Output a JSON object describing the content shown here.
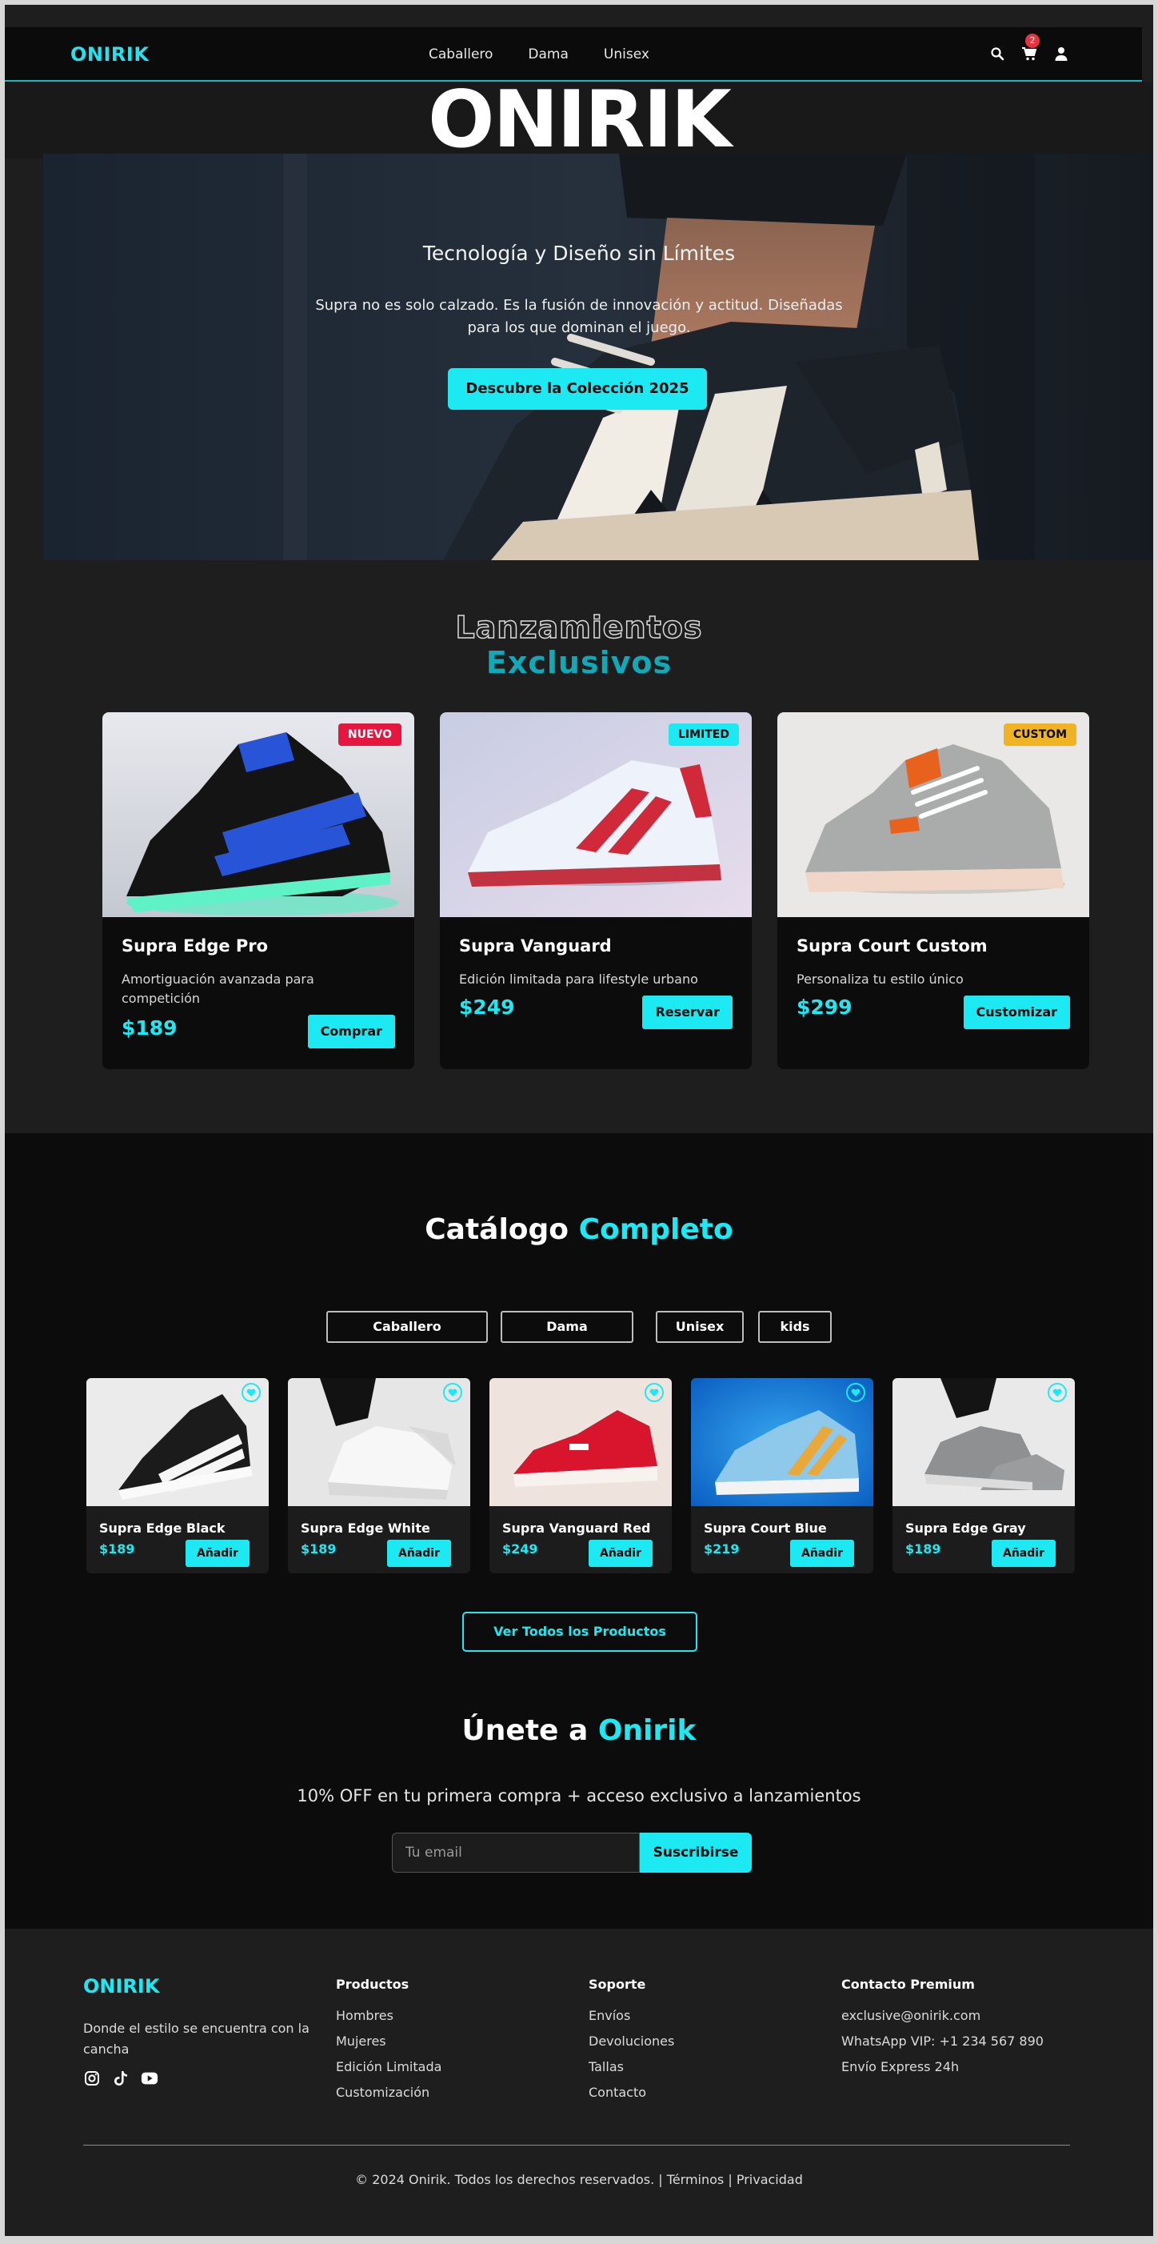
{
  "nav": {
    "logo": "ONIRIK",
    "links": [
      "Caballero",
      "Dama",
      "Unisex"
    ],
    "cart_count": "2"
  },
  "hero": {
    "brand": "ONIRIK",
    "title": "Tecnología y Diseño sin Límites",
    "subtitle": "Supra no es solo calzado. Es la fusión de innovación y actitud. Diseñadas para los que dominan el juego.",
    "cta": "Descubre la Colección 2025"
  },
  "launches": {
    "title_line1": "Lanzamientos",
    "title_line2": "Exclusivos",
    "items": [
      {
        "badge": "NUEVO",
        "badge_color": "#e5173f",
        "name": "Supra Edge Pro",
        "description": "Amortiguación avanzada para competición",
        "price": "$189",
        "button": "Comprar"
      },
      {
        "badge": "LIMITED",
        "badge_color": "#1de9f3",
        "name": "Supra Vanguard",
        "description": "Edición limitada para lifestyle urbano",
        "price": "$249",
        "button": "Reservar"
      },
      {
        "badge": "CUSTOM",
        "badge_color": "#f0b323",
        "name": "Supra Court Custom",
        "description": "Personaliza tu estilo único",
        "price": "$299",
        "button": "Customizar"
      }
    ]
  },
  "catalog": {
    "title_a": "Catálogo",
    "title_b": "Completo",
    "filters": [
      "Caballero",
      "Dama",
      "Unisex",
      "kids"
    ],
    "products": [
      {
        "name": "Supra Edge Black",
        "price": "$189",
        "button": "Añadir"
      },
      {
        "name": "Supra Edge White",
        "price": "$189",
        "button": "Añadir"
      },
      {
        "name": "Supra Vanguard Red",
        "price": "$249",
        "button": "Añadir"
      },
      {
        "name": "Supra Court Blue",
        "price": "$219",
        "button": "Añadir"
      },
      {
        "name": "Supra Edge Gray",
        "price": "$189",
        "button": "Añadir"
      }
    ],
    "view_all": "Ver Todos los Productos"
  },
  "newsletter": {
    "title_a": "Únete a",
    "title_b": "Onirik",
    "subtitle": "10% OFF en tu primera compra + acceso exclusivo a lanzamientos",
    "placeholder": "Tu email",
    "button": "Suscribirse"
  },
  "footer": {
    "logo": "ONIRIK",
    "tagline": "Donde el estilo se encuentra con la cancha",
    "social": [
      "instagram-icon",
      "tiktok-icon",
      "youtube-icon"
    ],
    "columns": [
      {
        "title": "Productos",
        "links": [
          "Hombres",
          "Mujeres",
          "Edición Limitada",
          "Customización"
        ]
      },
      {
        "title": "Soporte",
        "links": [
          "Envíos",
          "Devoluciones",
          "Tallas",
          "Contacto"
        ]
      },
      {
        "title": "Contacto Premium",
        "links": [
          "exclusive@onirik.com",
          "WhatsApp VIP: +1 234 567 890",
          "Envío Express 24h"
        ]
      }
    ],
    "copyright": "© 2024 Onirik. Todos los derechos reservados. | Términos | Privacidad"
  },
  "colors": {
    "accent": "#1de9f3",
    "background": "#1e1e1e",
    "dark": "#0c0c0c"
  }
}
